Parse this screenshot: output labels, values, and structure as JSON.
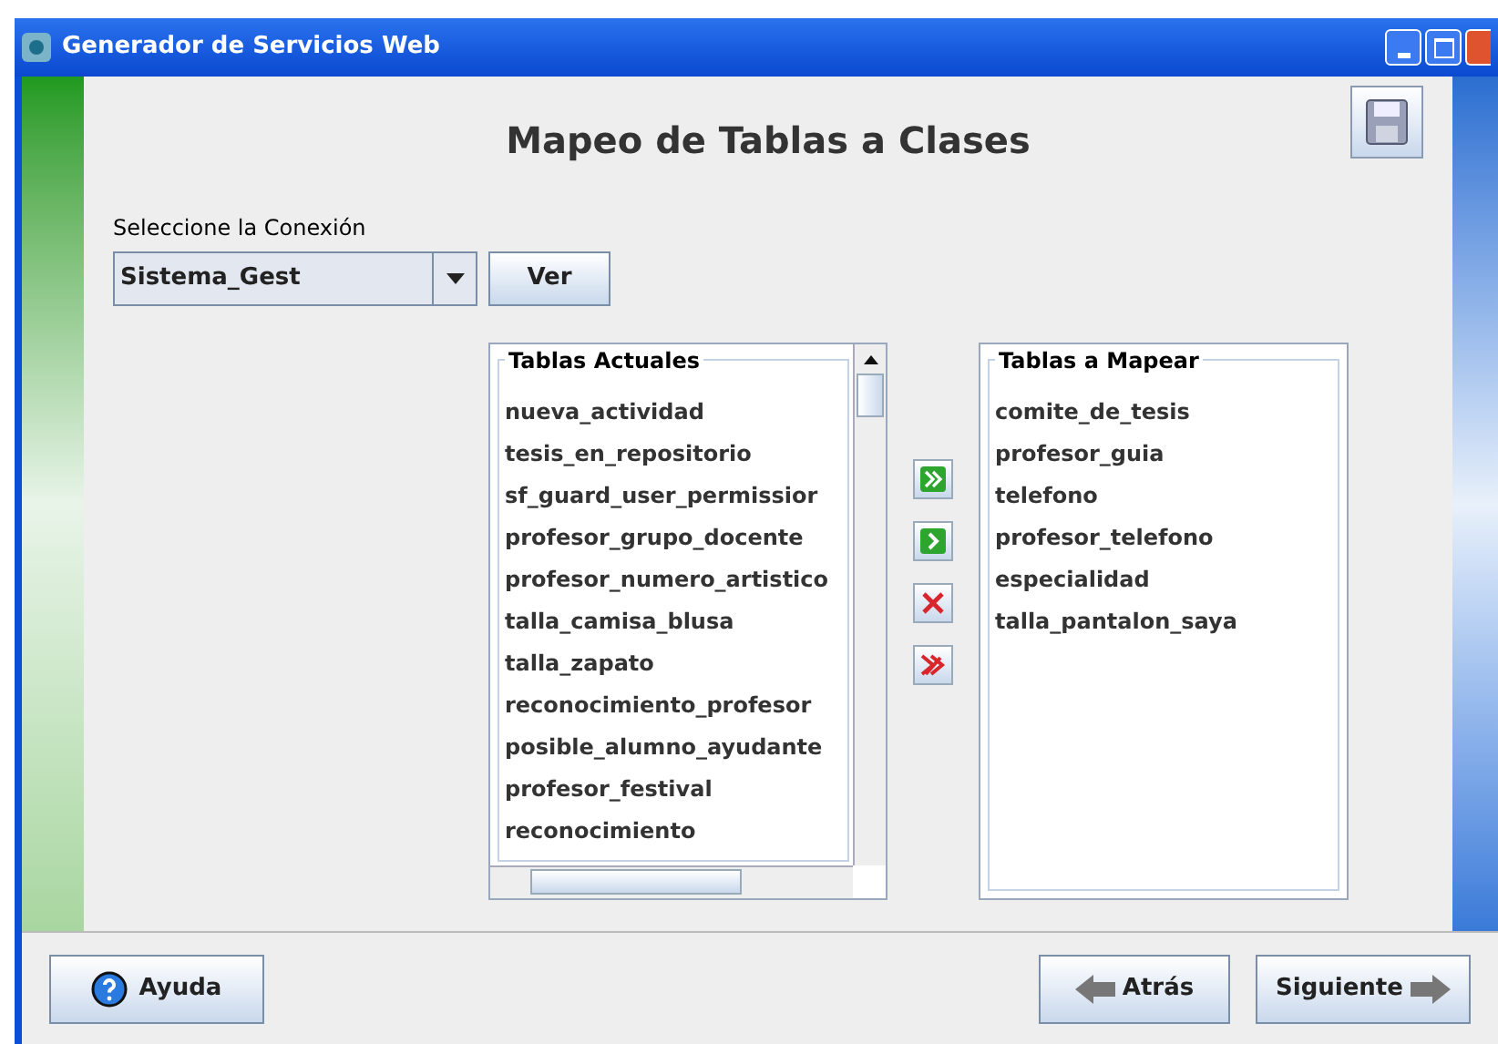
{
  "window": {
    "title": "Generador de Servicios Web"
  },
  "heading": "Mapeo de Tablas a Clases",
  "connection": {
    "label": "Seleccione la Conexión",
    "value": "Sistema_Gest",
    "button": "Ver"
  },
  "current_tables": {
    "title": "Tablas Actuales",
    "items": [
      "nueva_actividad",
      "tesis_en_repositorio",
      "sf_guard_user_permissior",
      "profesor_grupo_docente",
      "profesor_numero_artistico",
      "talla_camisa_blusa",
      "talla_zapato",
      "reconocimiento_profesor",
      "posible_alumno_ayudante",
      "profesor_festival",
      "reconocimiento"
    ]
  },
  "move_buttons": [
    {
      "kind": "add-all"
    },
    {
      "kind": "add"
    },
    {
      "kind": "remove"
    },
    {
      "kind": "remove-all"
    }
  ],
  "mapped_tables": {
    "title": "Tablas a Mapear",
    "items": [
      "comite_de_tesis",
      "profesor_guia",
      "telefono",
      "profesor_telefono",
      "especialidad",
      "talla_pantalon_saya"
    ]
  },
  "footer": {
    "help": "Ayuda",
    "back": "Atrás",
    "next": "Siguiente"
  }
}
